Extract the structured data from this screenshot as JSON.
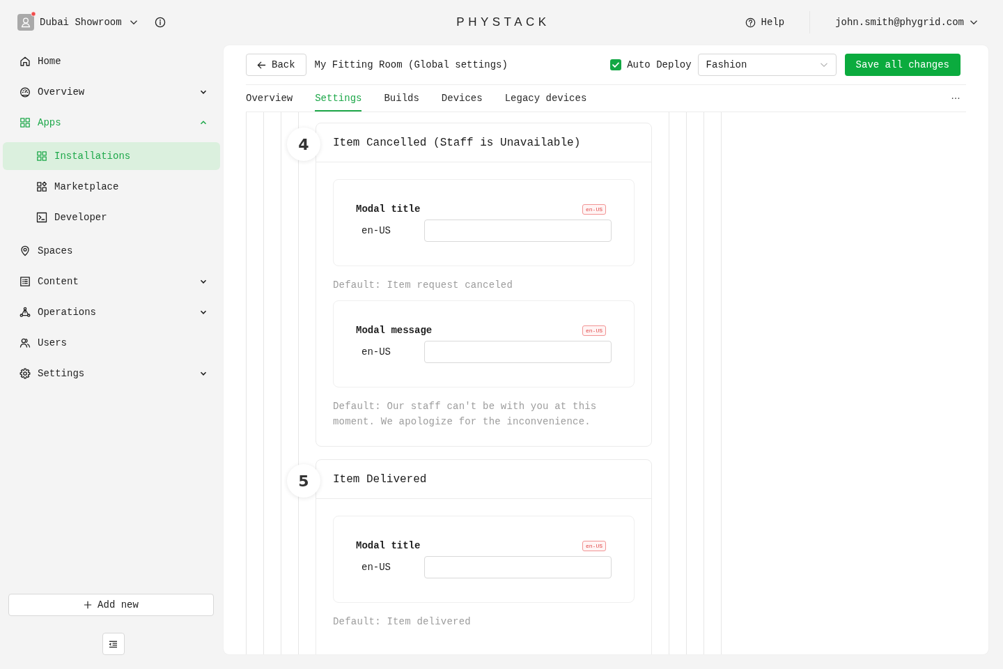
{
  "top_bar": {
    "workspace": "Dubai Showroom",
    "notification": true,
    "logo": "PHYSTACK",
    "help": "Help",
    "account": "john.smith@phygrid.com"
  },
  "sidebar": {
    "items": [
      {
        "label": "Home",
        "selected": false
      },
      {
        "label": "Overview",
        "selected": false,
        "expanded": false
      },
      {
        "label": "Apps",
        "selected": false,
        "expanded": true,
        "children": [
          {
            "label": "Installations",
            "selected": true
          },
          {
            "label": "Marketplace",
            "selected": false
          },
          {
            "label": "Developer",
            "selected": false
          }
        ]
      },
      {
        "label": "Spaces",
        "selected": false
      },
      {
        "label": "Content",
        "selected": false,
        "expanded": false
      },
      {
        "label": "Operations",
        "selected": false,
        "expanded": false
      },
      {
        "label": "Users",
        "selected": false
      },
      {
        "label": "Settings",
        "selected": false,
        "expanded": false
      }
    ],
    "add_button": "Add new"
  },
  "header": {
    "back_button": "Back",
    "title": "My Fitting Room (Global settings)",
    "auto_deploy": {
      "label": "Auto Deploy",
      "checked": true
    },
    "category_select": {
      "value": "Fashion"
    },
    "save_button": "Save all changes"
  },
  "tabs": [
    {
      "label": "Overview",
      "selected": false
    },
    {
      "label": "Settings",
      "selected": true
    },
    {
      "label": "Builds",
      "selected": false
    },
    {
      "label": "Devices",
      "selected": false
    },
    {
      "label": "Legacy devices",
      "selected": false
    }
  ],
  "steps": [
    {
      "number": "4",
      "title": "Item Cancelled (Staff is Unavailable)",
      "fields": [
        {
          "label": "Modal title",
          "badge": "en-US",
          "locale": "en-US",
          "default": "Default: Item request canceled"
        },
        {
          "label": "Modal message",
          "badge": "en-US",
          "locale": "en-US",
          "default": "Default: Our staff can't be with you at this moment. We apologize for the inconvenience."
        }
      ]
    },
    {
      "number": "5",
      "title": "Item Delivered",
      "fields": [
        {
          "label": "Modal title",
          "badge": "en-US",
          "locale": "en-US",
          "default": "Default: Item delivered"
        }
      ]
    }
  ]
}
